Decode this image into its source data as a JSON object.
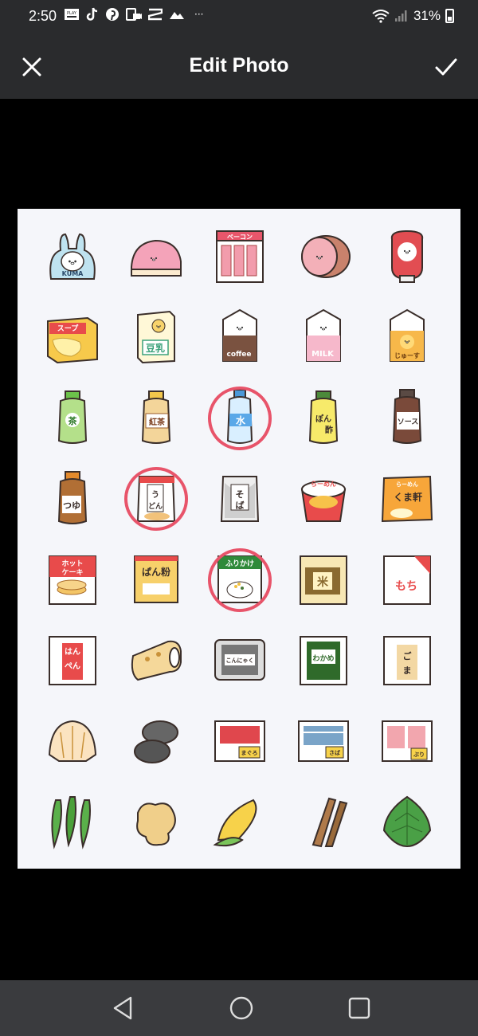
{
  "status": {
    "time": "2:50",
    "notif_icons": [
      "play-store-icon",
      "tiktok-icon",
      "pinterest-icon",
      "screen-record-icon",
      "capcut-icon",
      "cloud-icon",
      "more-icon"
    ],
    "battery": "31%"
  },
  "appbar": {
    "title": "Edit Photo"
  },
  "photo": {
    "items": [
      {
        "name": "kuma-bag",
        "text": "KUMA"
      },
      {
        "name": "kamaboko",
        "text": ""
      },
      {
        "name": "bacon",
        "text": "ベーコン"
      },
      {
        "name": "ham",
        "text": ""
      },
      {
        "name": "ketchup",
        "text": ""
      },
      {
        "name": "soup-box",
        "text": "スープ"
      },
      {
        "name": "soy-milk",
        "text": "豆乳"
      },
      {
        "name": "coffee-carton",
        "text": "coffee"
      },
      {
        "name": "milk-carton",
        "text": "MILK"
      },
      {
        "name": "juice-carton",
        "text": "じゅーす"
      },
      {
        "name": "green-tea-bottle",
        "text": "茶"
      },
      {
        "name": "black-tea-bottle",
        "text": "紅茶"
      },
      {
        "name": "water-bottle",
        "text": "水"
      },
      {
        "name": "ponzu-bottle",
        "text": "ぽん酢"
      },
      {
        "name": "sauce-bottle",
        "text": "ソース"
      },
      {
        "name": "tsuyu-bottle",
        "text": "つゆ"
      },
      {
        "name": "udon-pack",
        "text": "うどん"
      },
      {
        "name": "soba-pack",
        "text": "そば"
      },
      {
        "name": "ramen-cup",
        "text": "らーめん"
      },
      {
        "name": "ramen-pack",
        "text": "くま軒"
      },
      {
        "name": "hotcake-box",
        "text": "ホットケーキ"
      },
      {
        "name": "panko-bag",
        "text": "ぱん粉"
      },
      {
        "name": "furikake-pack",
        "text": "ふりかけ"
      },
      {
        "name": "rice-bag",
        "text": "米"
      },
      {
        "name": "mochi-pack",
        "text": "もち"
      },
      {
        "name": "hanpen-pack",
        "text": "はんぺん"
      },
      {
        "name": "chikuwa",
        "text": ""
      },
      {
        "name": "konnyaku-pack",
        "text": "こんにゃく"
      },
      {
        "name": "wakame-pack",
        "text": "わかめ"
      },
      {
        "name": "sesame-pack",
        "text": "ごま"
      },
      {
        "name": "clam-shell",
        "text": ""
      },
      {
        "name": "black-clams",
        "text": ""
      },
      {
        "name": "tuna-tray",
        "text": "まぐろ"
      },
      {
        "name": "mackerel-tray",
        "text": "さば"
      },
      {
        "name": "yellowtail-tray",
        "text": "ぶり"
      },
      {
        "name": "okra",
        "text": ""
      },
      {
        "name": "ginger",
        "text": ""
      },
      {
        "name": "corn",
        "text": ""
      },
      {
        "name": "burdock",
        "text": ""
      },
      {
        "name": "shiso-leaf",
        "text": ""
      }
    ],
    "highlighted": [
      "water-bottle",
      "udon-pack",
      "furikake-pack"
    ],
    "highlight_color": "#e8546a"
  },
  "colors": {
    "bar": "#2a2b2d",
    "nav": "#3a3b3e"
  }
}
